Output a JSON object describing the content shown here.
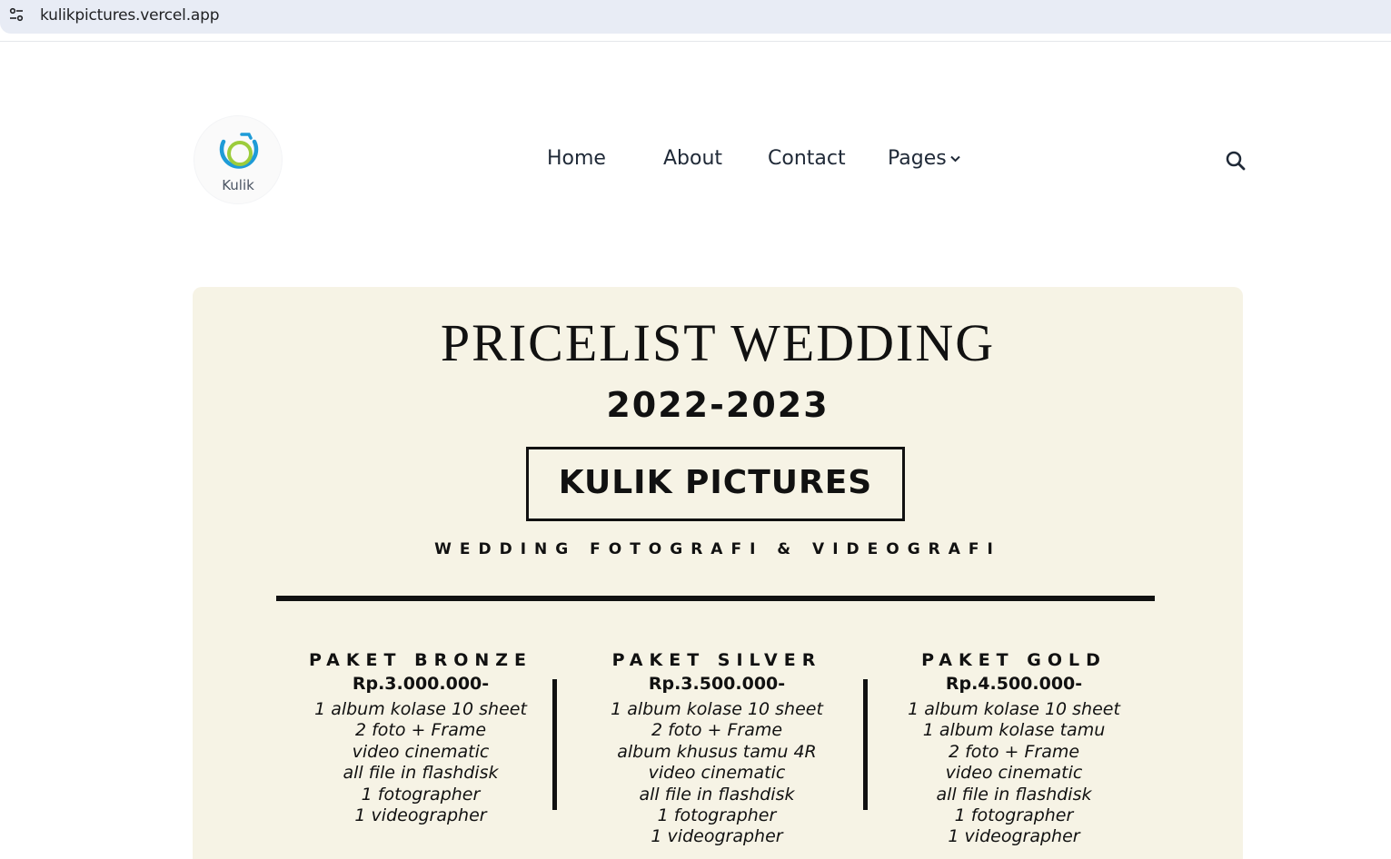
{
  "browser": {
    "url": "kulikpictures.vercel.app",
    "site_info_icon": "tune-icon"
  },
  "header": {
    "logo_text": "Kulik",
    "logo_icon": "camera-ring-icon",
    "logo_colors": {
      "blue": "#1e9bd7",
      "green": "#9ccc3c"
    },
    "nav": {
      "home": "Home",
      "about": "About",
      "contact": "Contact",
      "pages": "Pages"
    },
    "search_icon": "search-icon"
  },
  "pricelist": {
    "title": "PRICELIST WEDDING",
    "year": "2022-2023",
    "brand": "KULIK PICTURES",
    "tagline": "WEDDING FOTOGRAFI & VIDEOGRAFI",
    "background": "#f6f3e5",
    "packages": [
      {
        "name": "PAKET BRONZE",
        "price": "Rp.3.000.000-",
        "features": [
          "1 album kolase 10 sheet",
          "2 foto + Frame",
          "video cinematic",
          "all file in flashdisk",
          "1 fotographer",
          "1 videographer"
        ]
      },
      {
        "name": "PAKET SILVER",
        "price": "Rp.3.500.000-",
        "features": [
          "1 album kolase 10 sheet",
          "2 foto + Frame",
          "album khusus tamu 4R",
          "video cinematic",
          "all file in flashdisk",
          "1 fotographer",
          "1 videographer"
        ]
      },
      {
        "name": "PAKET GOLD",
        "price": "Rp.4.500.000-",
        "features": [
          "1 album kolase 10 sheet",
          "1 album kolase tamu",
          "2 foto + Frame",
          "video cinematic",
          "all file in flashdisk",
          "1 fotographer",
          "1 videographer"
        ]
      }
    ]
  }
}
